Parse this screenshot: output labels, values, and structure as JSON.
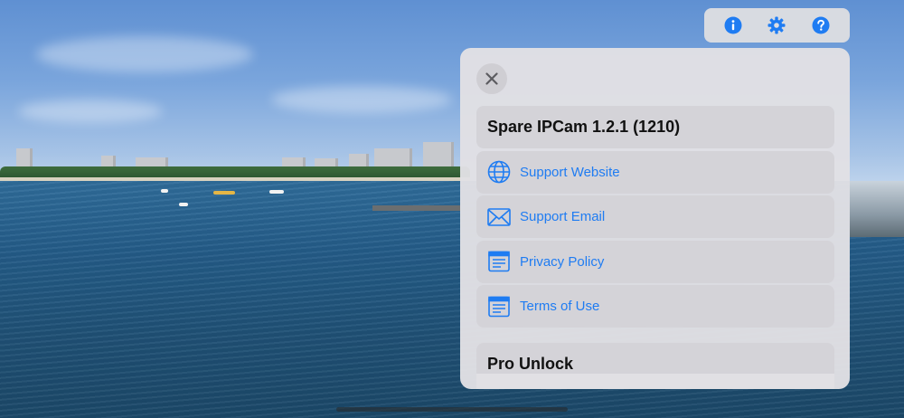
{
  "toolbar": {
    "info_icon": "info-circle-icon",
    "settings_icon": "gear-icon",
    "help_icon": "question-circle-icon",
    "accent": "#1f7cf2"
  },
  "panel": {
    "close_icon": "close-icon",
    "app_title": "Spare IPCam 1.2.1 (1210)",
    "links": [
      {
        "label": "Support Website",
        "icon": "globe-icon"
      },
      {
        "label": "Support Email",
        "icon": "envelope-icon"
      },
      {
        "label": "Privacy Policy",
        "icon": "document-icon"
      },
      {
        "label": "Terms of Use",
        "icon": "document-icon"
      }
    ],
    "pro_section_title": "Pro Unlock"
  },
  "colors": {
    "link": "#1f7cf2",
    "panel_bg": "#e1e0e4",
    "row_bg": "#d4d3d8"
  }
}
